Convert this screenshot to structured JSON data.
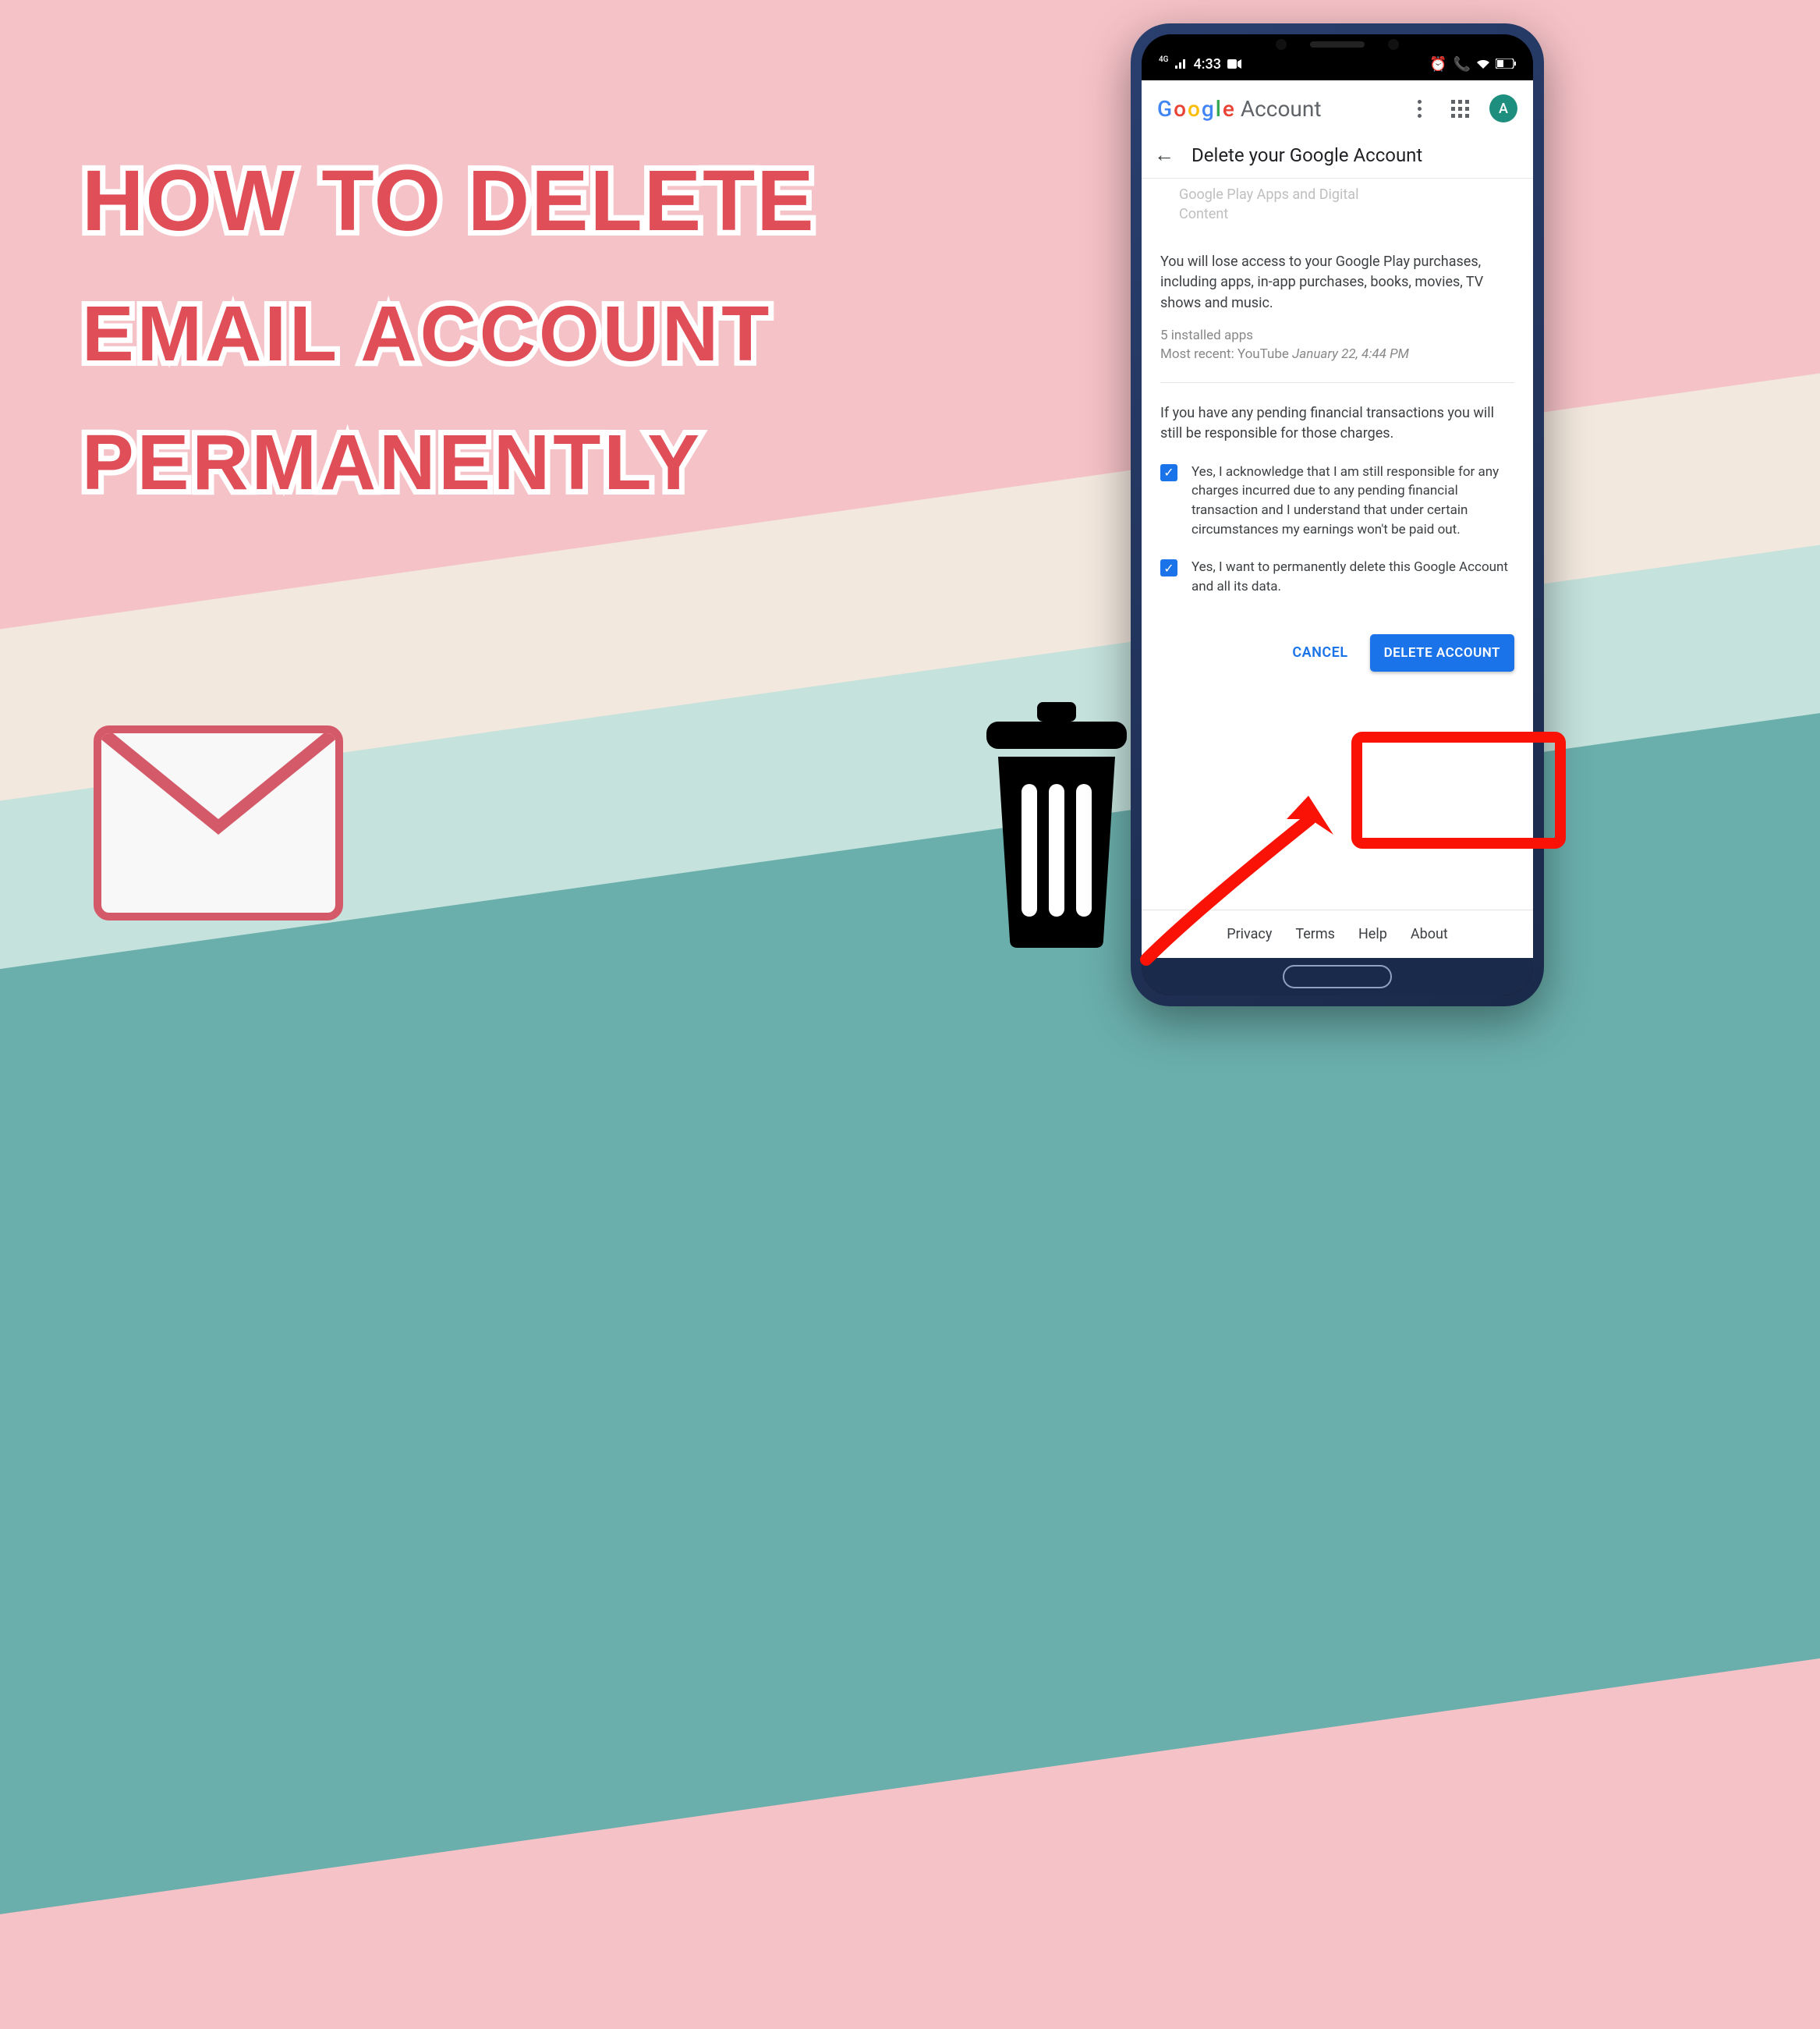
{
  "headline": {
    "line1": "How To Delete",
    "line2": "EMAIL ACCOUNT",
    "line3": "PERMANENTLY"
  },
  "status_bar": {
    "time": "4:33",
    "network_prefix": "4G"
  },
  "app_header": {
    "brand_word": "Google",
    "brand_suffix": "Account",
    "avatar_initial": "A"
  },
  "subheader": {
    "title": "Delete your Google Account"
  },
  "content": {
    "faded_line1": "Google Play Apps and Digital",
    "faded_line2": "Content",
    "p1": "You will lose access to your Google Play purchases, including apps, in-app purchases, books, movies, TV shows and music.",
    "meta_apps": "5 installed apps",
    "meta_recent_prefix": "Most recent: YouTube ",
    "meta_recent_date": "January 22, 4:44 PM",
    "p2": "If you have any pending financial transactions you will still be responsible for those charges.",
    "check1": "Yes, I acknowledge that I am still responsible for any charges incurred due to any pending financial transaction and I understand that under certain circumstances my earnings won't be paid out.",
    "check2": "Yes, I want to permanently delete this Google Account and all its data."
  },
  "actions": {
    "cancel": "CANCEL",
    "delete": "DELETE ACCOUNT"
  },
  "footer": {
    "privacy": "Privacy",
    "terms": "Terms",
    "help": "Help",
    "about": "About"
  }
}
